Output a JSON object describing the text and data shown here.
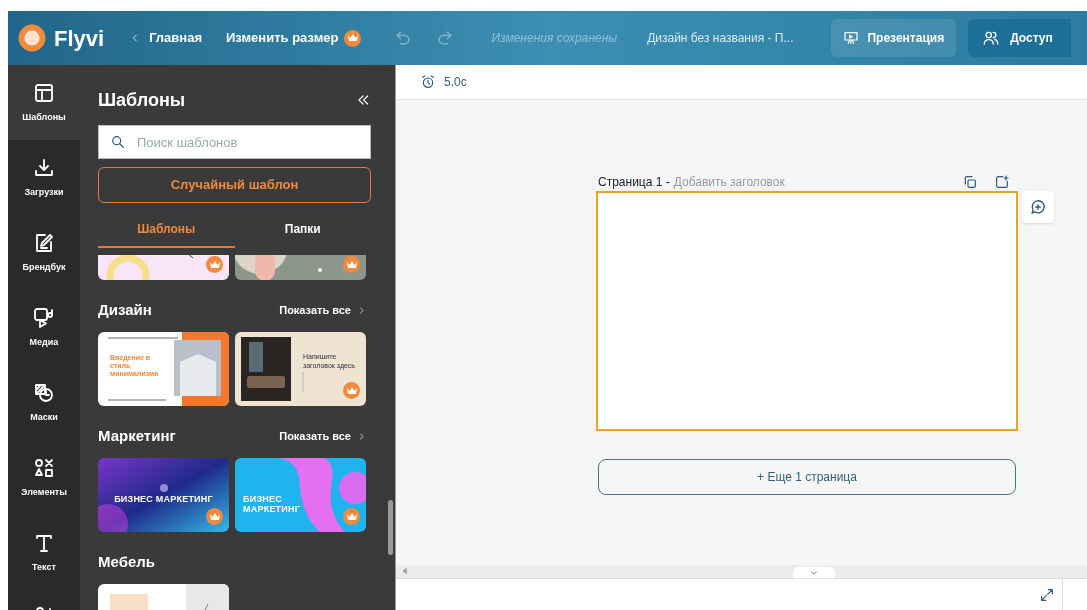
{
  "topbar": {
    "app_name": "Flyvi",
    "back_label": "Главная",
    "resize_label": "Изменить размер",
    "resize_premium": true,
    "undo_enabled": false,
    "redo_enabled": false,
    "save_status": "Изменения сохранены",
    "document_title": "Дизайн без названия - П...",
    "present_label": "Презентация",
    "share_label": "Доступ"
  },
  "rail": [
    {
      "kind": "templates",
      "label": "Шаблоны",
      "selected": true
    },
    {
      "kind": "uploads",
      "label": "Загрузки",
      "selected": false
    },
    {
      "kind": "brandbook",
      "label": "Брендбук",
      "selected": false
    },
    {
      "kind": "media",
      "label": "Медиа",
      "selected": false
    },
    {
      "kind": "masks",
      "label": "Маски",
      "selected": false
    },
    {
      "kind": "elements",
      "label": "Элементы",
      "selected": false
    },
    {
      "kind": "text",
      "label": "Текст",
      "selected": false
    },
    {
      "kind": "more",
      "selected": false
    }
  ],
  "panel": {
    "title": "Шаблоны",
    "search": {
      "placeholder": "Поиск шаблонов"
    },
    "random_button": "Случайный шаблон",
    "tabs": [
      {
        "label": "Шаблоны",
        "selected": true
      },
      {
        "label": "Папки",
        "selected": false
      }
    ],
    "top_row": [
      {
        "kind": "pastel",
        "premium": true
      },
      {
        "kind": "sage",
        "premium": true
      }
    ],
    "sections": [
      {
        "title": "Дизайн",
        "show_all": "Показать все",
        "templates": [
          {
            "kind": "minimal",
            "title": "Введение в стиль минимализма",
            "premium": false
          },
          {
            "kind": "interior",
            "title": "Напишите заголовок здесь",
            "premium": true
          }
        ]
      },
      {
        "title": "Маркетинг",
        "show_all": "Показать все",
        "templates": [
          {
            "kind": "gradient",
            "title": "БИЗНЕС МАРКЕТИНГ",
            "premium": true
          },
          {
            "kind": "wave",
            "title": "БИЗНЕС МАРКЕТИНГ",
            "premium": true
          }
        ]
      },
      {
        "title": "Мебель",
        "templates": [
          {
            "kind": "furniture",
            "premium": false
          }
        ]
      }
    ]
  },
  "editor": {
    "duration": "5.0с",
    "page_label": "Страница 1 -",
    "page_title_placeholder": "Добавить заголовок",
    "add_page_button": "+ Еще 1 страница"
  }
}
